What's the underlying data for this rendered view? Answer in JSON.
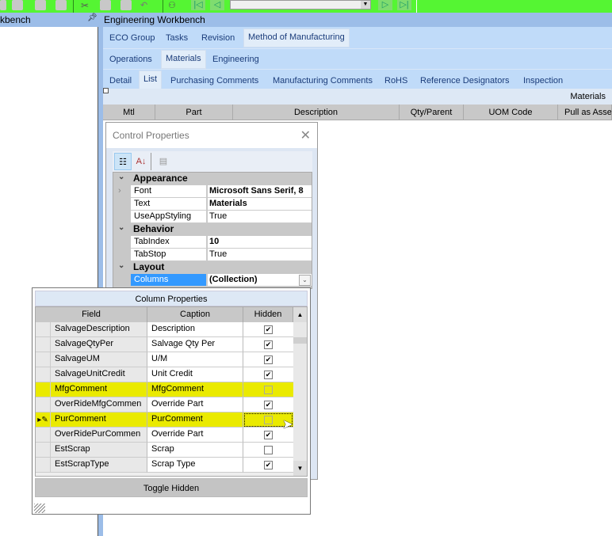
{
  "left_panel": {
    "title": "kbench",
    "pin_icon": "pin-icon"
  },
  "main": {
    "title": "Engineering Workbench"
  },
  "tabs_l1": [
    {
      "label": "ECO Group"
    },
    {
      "label": "Tasks"
    },
    {
      "label": "Revision"
    },
    {
      "label": "Method of Manufacturing",
      "selected": true
    }
  ],
  "tabs_l2": [
    {
      "label": "Operations"
    },
    {
      "label": "Materials",
      "selected": true
    },
    {
      "label": "Engineering"
    }
  ],
  "tabs_l3": [
    {
      "label": "Detail"
    },
    {
      "label": "List",
      "selected": true
    },
    {
      "label": "Purchasing Comments"
    },
    {
      "label": "Manufacturing Comments"
    },
    {
      "label": "RoHS"
    },
    {
      "label": "Reference Designators"
    },
    {
      "label": "Inspection"
    }
  ],
  "grid": {
    "caption": "Materials",
    "columns": [
      "Mtl",
      "Part",
      "Description",
      "Qty/Parent",
      "UOM Code",
      "Pull as Asse"
    ]
  },
  "control_properties": {
    "title": "Control Properties",
    "categories": [
      {
        "name": "Appearance",
        "props": [
          {
            "name": "Font",
            "value": "Microsoft Sans Serif, 8"
          },
          {
            "name": "Text",
            "value": "Materials"
          },
          {
            "name": "UseAppStyling",
            "value": "True"
          }
        ]
      },
      {
        "name": "Behavior",
        "props": [
          {
            "name": "TabIndex",
            "value": "10"
          },
          {
            "name": "TabStop",
            "value": "True"
          }
        ]
      },
      {
        "name": "Layout",
        "props": [
          {
            "name": "Columns",
            "value": "(Collection)"
          }
        ]
      }
    ]
  },
  "column_properties": {
    "title": "Column Properties",
    "headers": [
      "Field",
      "Caption",
      "Hidden"
    ],
    "rows": [
      {
        "field": "SalvageDescription",
        "caption": "Description",
        "hidden": true
      },
      {
        "field": "SalvageQtyPer",
        "caption": "Salvage Qty Per",
        "hidden": true
      },
      {
        "field": "SalvageUM",
        "caption": "U/M",
        "hidden": true
      },
      {
        "field": "SalvageUnitCredit",
        "caption": "Unit Credit",
        "hidden": true
      },
      {
        "field": "MfgComment",
        "caption": "MfgComment",
        "hidden": false,
        "highlighted": true
      },
      {
        "field": "OverRideMfgCommen",
        "caption": "Override Part",
        "hidden": true
      },
      {
        "field": "PurComment",
        "caption": "PurComment",
        "hidden": false,
        "highlighted": true,
        "current": true
      },
      {
        "field": "OverRidePurCommen",
        "caption": "Override Part",
        "hidden": true
      },
      {
        "field": "EstScrap",
        "caption": "Scrap",
        "hidden": false
      },
      {
        "field": "EstScrapType",
        "caption": "Scrap Type",
        "hidden": true
      }
    ],
    "toggle_label": "Toggle Hidden"
  },
  "colors": {
    "toolbar": "#55f533",
    "header": "#9cbde8",
    "tabs": "#c0dbf9",
    "highlight": "#eaea00",
    "selected_prop": "#3399ff"
  }
}
